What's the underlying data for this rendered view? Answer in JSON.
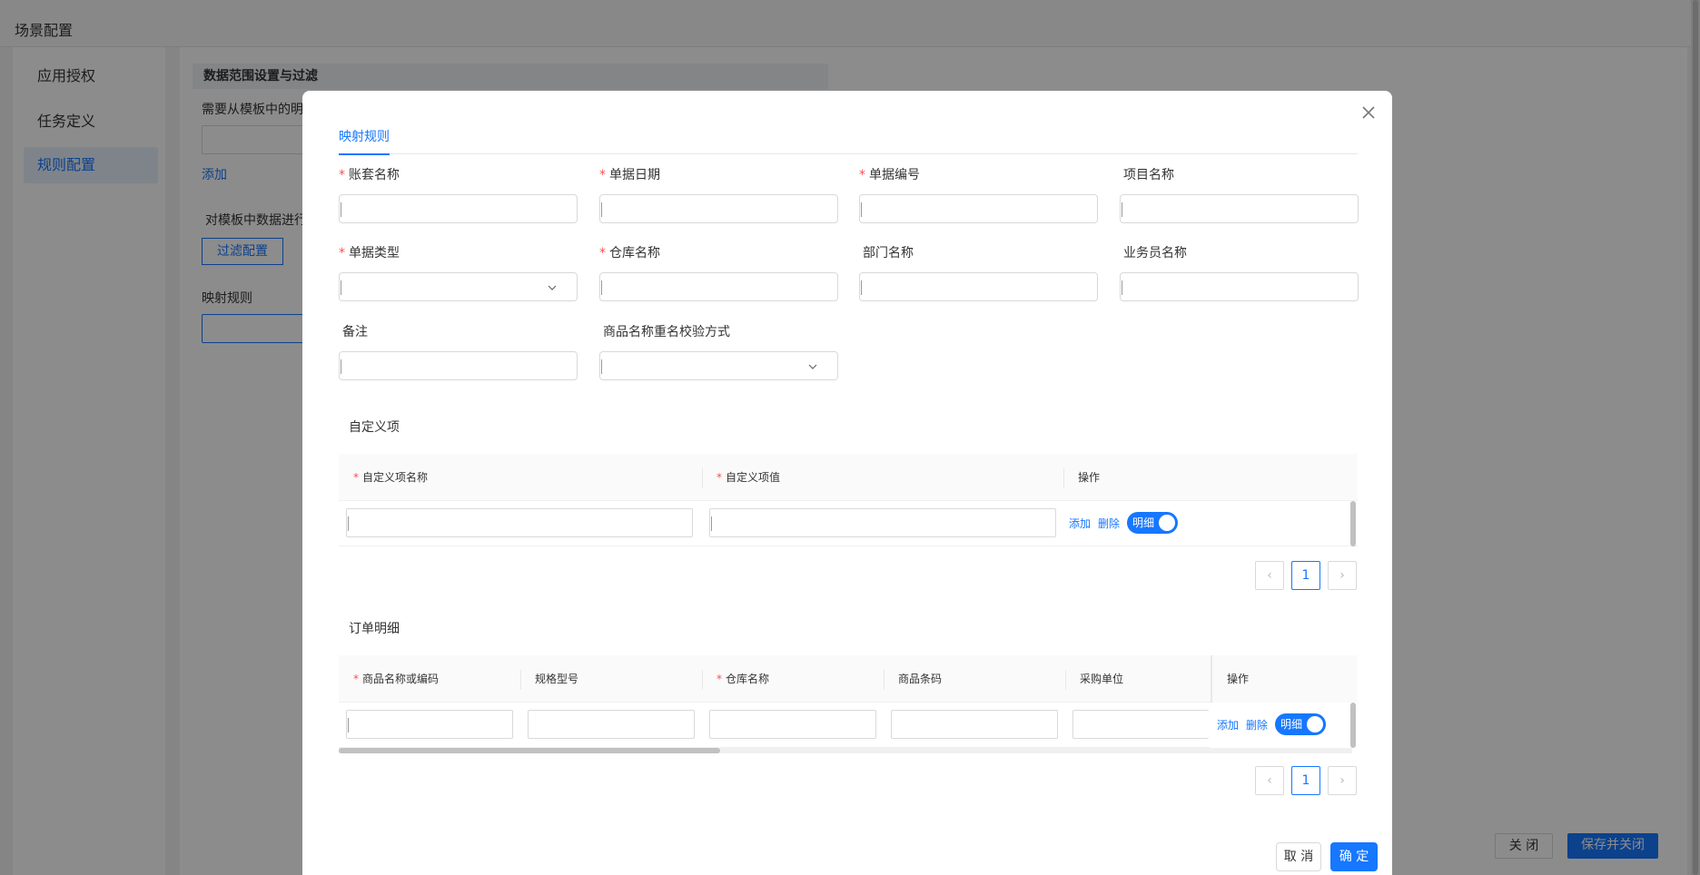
{
  "background": {
    "page_title": "场景配置",
    "sidebar": {
      "items": [
        {
          "label": "应用授权"
        },
        {
          "label": "任务定义"
        },
        {
          "label": "规则配置"
        }
      ]
    },
    "section_title": "数据范围设置与过滤",
    "detail_hint": "需要从模板中的明",
    "add_link": "添加",
    "filter_hint": "对模板中数据进行",
    "filter_button": "过滤配置",
    "mapping_label": "映射规则",
    "close_button": "关 闭",
    "save_close_button": "保存并关闭"
  },
  "modal": {
    "tab_label": "映射规则",
    "fields": [
      {
        "label": "账套名称",
        "required": "*",
        "type": "input",
        "value": ""
      },
      {
        "label": "单据日期",
        "required": "*",
        "type": "input",
        "value": ""
      },
      {
        "label": "单据编号",
        "required": "*",
        "type": "input",
        "value": ""
      },
      {
        "label": "项目名称",
        "required": "",
        "type": "input",
        "value": ""
      },
      {
        "label": "单据类型",
        "required": "*",
        "type": "select",
        "value": ""
      },
      {
        "label": "仓库名称",
        "required": "*",
        "type": "input",
        "value": ""
      },
      {
        "label": "部门名称",
        "required": "",
        "type": "input",
        "value": ""
      },
      {
        "label": "业务员名称",
        "required": "",
        "type": "input",
        "value": ""
      },
      {
        "label": "备注",
        "required": "",
        "type": "input",
        "value": ""
      },
      {
        "label": "商品名称重名校验方式",
        "required": "",
        "type": "select",
        "value": ""
      }
    ],
    "custom_section": {
      "title": "自定义项",
      "columns": [
        {
          "label": "自定义项名称",
          "required": "*"
        },
        {
          "label": "自定义项值",
          "required": "*"
        },
        {
          "label": "操作",
          "required": ""
        }
      ],
      "row": {
        "add": "添加",
        "delete": "删除",
        "switch_label": "明细",
        "switch_on": true
      },
      "pagination": {
        "current": "1",
        "prev": "‹",
        "next": "›"
      }
    },
    "order_section": {
      "title": "订单明细",
      "columns": [
        {
          "label": "商品名称或编码",
          "required": "*"
        },
        {
          "label": "规格型号",
          "required": ""
        },
        {
          "label": "仓库名称",
          "required": "*"
        },
        {
          "label": "商品条码",
          "required": ""
        },
        {
          "label": "采购单位",
          "required": ""
        },
        {
          "label": "操作",
          "required": ""
        }
      ],
      "row": {
        "add": "添加",
        "delete": "删除",
        "switch_label": "明细",
        "switch_on": true
      },
      "pagination": {
        "current": "1",
        "prev": "‹",
        "next": "›"
      }
    },
    "footer": {
      "cancel": "取 消",
      "ok": "确 定"
    }
  },
  "colors": {
    "primary": "#1677ff",
    "required": "#ff4d4f",
    "mask": "rgba(0,0,0,0.45)"
  }
}
